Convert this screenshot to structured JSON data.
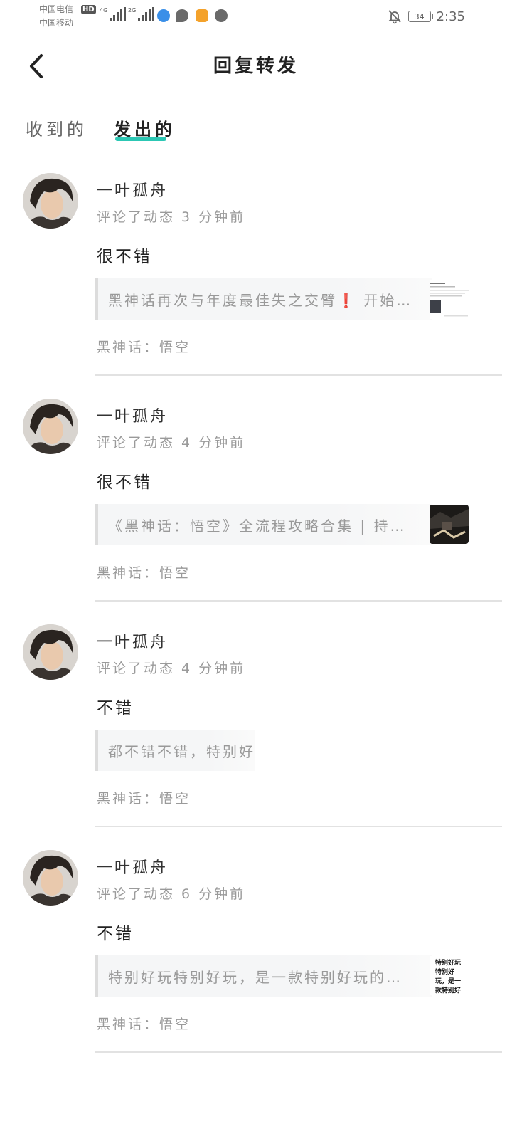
{
  "status_bar": {
    "carrier1": "中国电信",
    "carrier2": "中国移动",
    "hd": "HD",
    "net1": "4G",
    "net2": "2G",
    "battery": "34",
    "time": "2:35"
  },
  "header": {
    "title": "回复转发"
  },
  "tabs": [
    {
      "label": "收到的"
    },
    {
      "label": "发出的"
    }
  ],
  "feed": [
    {
      "name": "一叶孤舟",
      "meta": "评论了动态 3 分钟前",
      "comment": "很不错",
      "quote": "黑神话再次与年度最佳失之交臂❗ 开始…",
      "topic": "黑神话：悟空",
      "thumb_type": "doc"
    },
    {
      "name": "一叶孤舟",
      "meta": "评论了动态 4 分钟前",
      "comment": "很不错",
      "quote": "《黑神话：悟空》全流程攻略合集 | 持…",
      "topic": "黑神话：悟空",
      "thumb_type": "game"
    },
    {
      "name": "一叶孤舟",
      "meta": "评论了动态 4 分钟前",
      "comment": "不错",
      "quote": "都不错不错，特别好",
      "topic": "黑神话：悟空",
      "thumb_type": "none"
    },
    {
      "name": "一叶孤舟",
      "meta": "评论了动态 6 分钟前",
      "comment": "不错",
      "quote": "特别好玩特别好玩，是一款特别好玩的…",
      "topic": "黑神话：悟空",
      "thumb_type": "text",
      "thumb_text": "特别好玩特别好玩，是一款特别好玩的游戏"
    }
  ],
  "colors": {
    "accent": "#2cc7b4",
    "muted_text": "#9a9a9a",
    "quote_bg": "#f5f6f7"
  }
}
